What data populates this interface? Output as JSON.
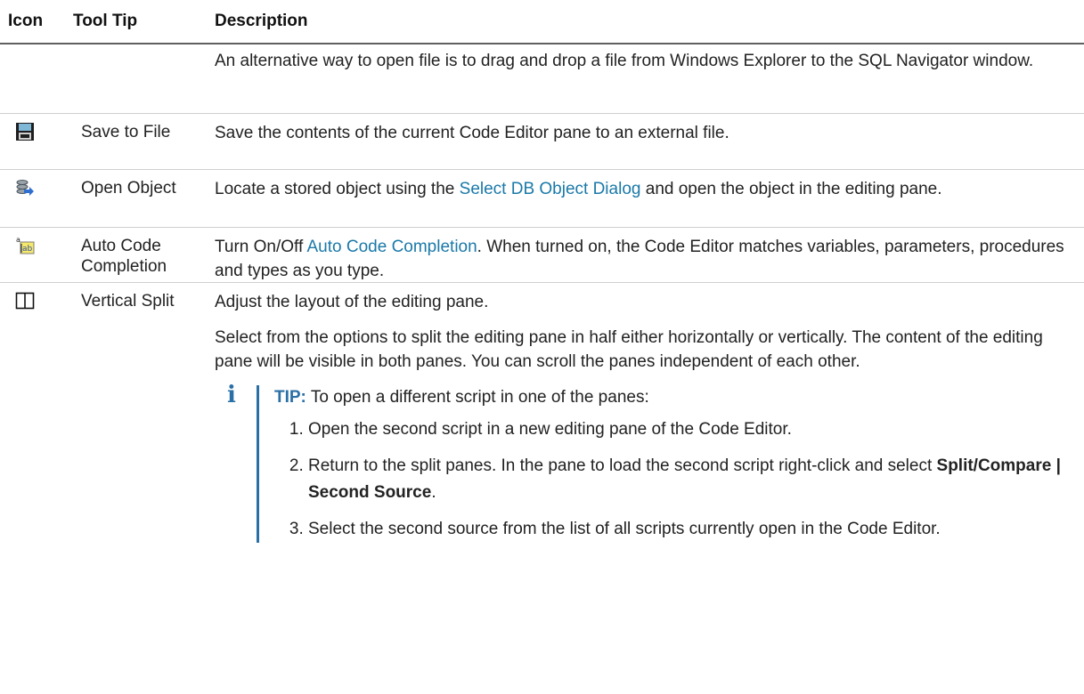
{
  "table": {
    "headers": {
      "icon": "Icon",
      "tooltip": "Tool Tip",
      "description": "Description"
    },
    "rows": [
      {
        "icon": "",
        "tooltip": "",
        "description": "An alternative way to open file is to drag and drop a file from Windows Explorer to the SQL Navigator window."
      },
      {
        "icon": "floppy-disk-icon",
        "tooltip": "Save to File",
        "description": "Save the contents of the current Code Editor pane to an external file."
      },
      {
        "icon": "open-object-icon",
        "tooltip": "Open Object",
        "description_before": "Locate a stored object using the ",
        "description_link": "Select DB Object Dialog",
        "description_after": " and open the object in the editing pane."
      },
      {
        "icon": "auto-code-completion-icon",
        "tooltip": "Auto Code Completion",
        "description_before": "Turn On/Off ",
        "description_link": "Auto Code Completion",
        "description_after": ". When turned on, the Code Editor matches variables, parameters, procedures and types as you type."
      },
      {
        "icon": "vertical-split-icon",
        "tooltip": "Vertical Split",
        "description_p1": "Adjust the layout of the editing pane.",
        "description_p2": "Select from the options to split the editing pane in half either horizontally or vertically. The content of the editing pane will be visible in both panes. You can scroll the panes independent of each other.",
        "tip": {
          "icon": "info-icon",
          "label": "TIP:",
          "text": " To open a different script in one of the panes:",
          "steps": [
            {
              "text": "Open the second script in a new editing pane of the Code Editor."
            },
            {
              "text": "Return to the split panes. In the pane to load the second script right-click and select ",
              "bold": "Split/Compare | Second Source",
              "after": "."
            },
            {
              "text": "Select the second source from the list of all scripts currently open in the Code Editor."
            }
          ]
        }
      }
    ]
  },
  "colors": {
    "link": "#1a79a8",
    "tip_accent": "#2a6fa5",
    "header_rule": "#606060"
  }
}
